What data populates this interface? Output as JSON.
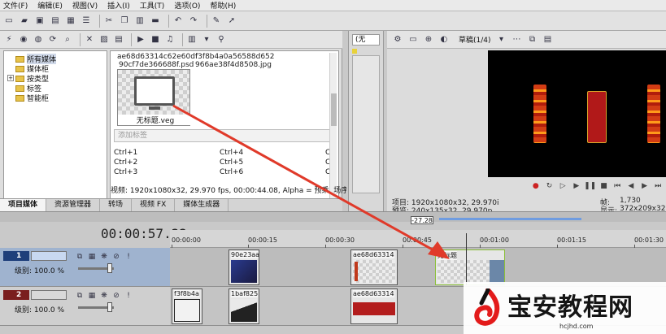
{
  "menu": [
    "文件(F)",
    "编辑(E)",
    "视图(V)",
    "插入(I)",
    "工具(T)",
    "选项(O)",
    "帮助(H)"
  ],
  "explorer": {
    "tree": [
      "所有媒体",
      "媒体柜",
      "按类型",
      "标签",
      "智能柜"
    ],
    "files": [
      "ae68d63314c62e60df",
      "f3f8b4a0a56588d652",
      "90cf7de366688f.psd",
      "966ae38f4d8508.jpg"
    ],
    "thumb_label": "无标题.veg",
    "tag_placeholder": "添加标签",
    "shortcuts": [
      [
        "Ctrl+1",
        "Ctrl+4",
        "Ct"
      ],
      [
        "Ctrl+2",
        "Ctrl+5",
        "Ct"
      ],
      [
        "Ctrl+3",
        "Ctrl+6",
        "Ct"
      ]
    ],
    "video_info": "视频: 1920x1080x32, 29.970 fps, 00:00:44.08, Alpha = 预乘, 场序"
  },
  "tabs": [
    "项目媒体",
    "资源管理器",
    "转场",
    "视频 FX",
    "媒体生成器"
  ],
  "mid_select": "(无",
  "preview": {
    "mode_label": "草稿(1/4)",
    "project": "项目: 1920x1080x32, 29.970i",
    "preview_res": "预览: 240x135x32, 29.970p",
    "frame_label": "帧:",
    "frame": "1,730",
    "display_label": "显示:",
    "display": "372x209x32"
  },
  "timeline": {
    "timecode": "00:00:57.22",
    "cursor_badge": "-27.28",
    "ruler": [
      "00:00:00",
      "00:00:15",
      "00:00:30",
      "00:00:45",
      "00:01:00",
      "00:01:15",
      "00:01:30"
    ],
    "tracks": [
      {
        "num": "1",
        "level": "级别: 100.0 %"
      },
      {
        "num": "2",
        "level": "级别: 100.0 %"
      }
    ],
    "clips_row1": [
      "90e23aa",
      "ae68d63314",
      "无标题"
    ],
    "clips_row2": [
      "f3f8b4a",
      "1baf825",
      "ae68d63314"
    ]
  },
  "watermark": {
    "title": "宝安教程网",
    "url": "hcjhd.com"
  },
  "colors": {
    "arrow": "#e03a2a",
    "track1": "#1e3f7a",
    "track2": "#7a1e1e"
  }
}
